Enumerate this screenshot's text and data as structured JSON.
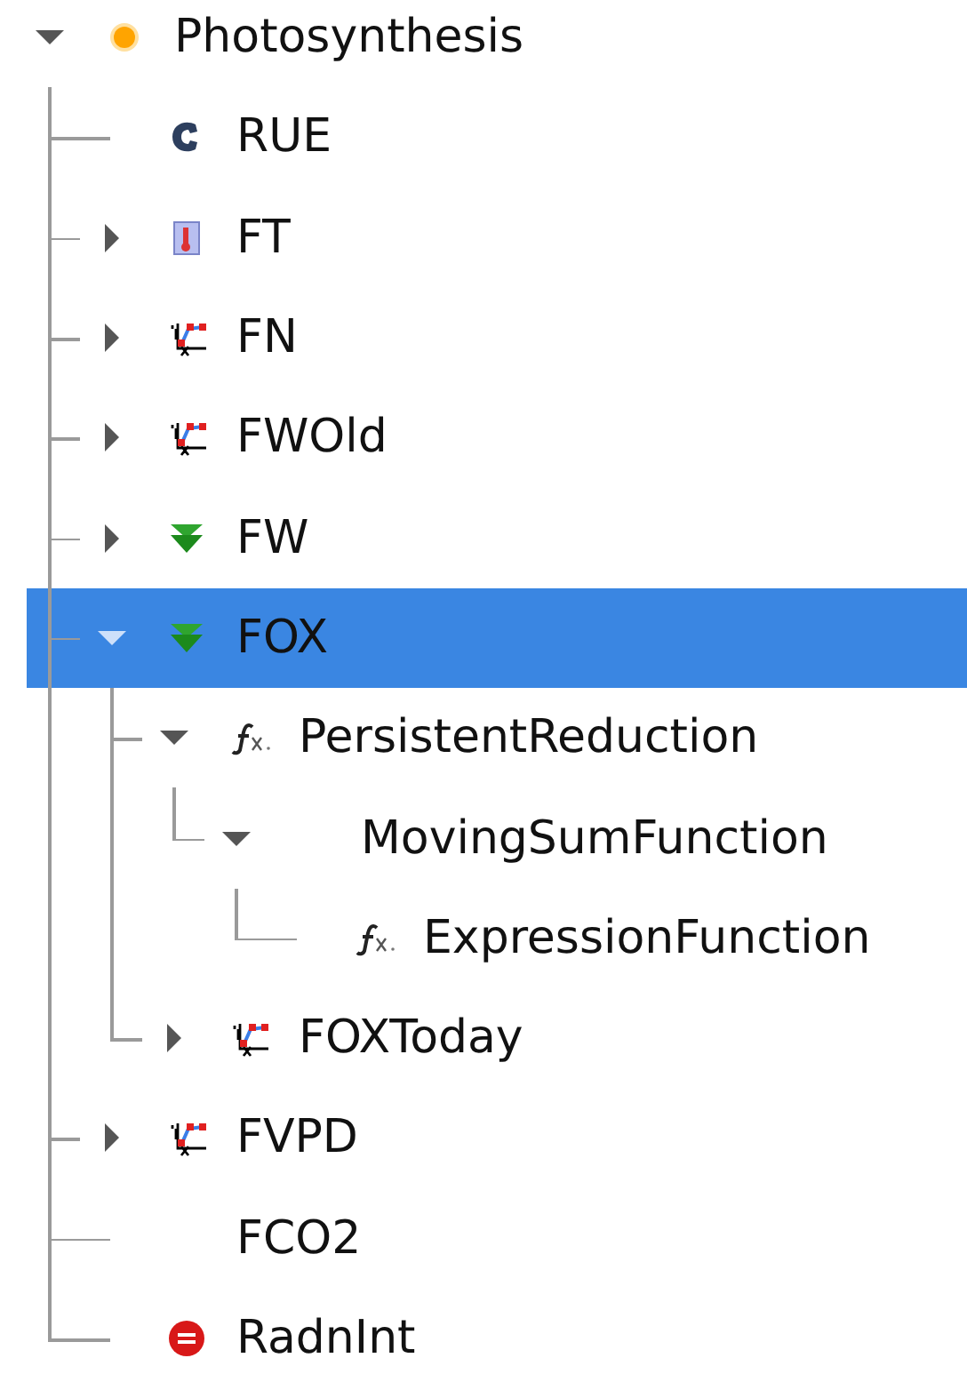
{
  "tree": [
    {
      "label": "Photosynthesis",
      "kind": "dot",
      "expanded": true,
      "selected": false,
      "children": [
        {
          "label": "RUE",
          "kind": "clamp",
          "selected": false
        },
        {
          "label": "FT",
          "kind": "thermometer",
          "expanded": false,
          "selected": false
        },
        {
          "label": "FN",
          "kind": "curve",
          "expanded": false,
          "selected": false
        },
        {
          "label": "FWOld",
          "kind": "curve",
          "expanded": false,
          "selected": false
        },
        {
          "label": "FW",
          "kind": "chevrons",
          "expanded": false,
          "selected": false
        },
        {
          "label": "FOX",
          "kind": "chevrons",
          "expanded": true,
          "selected": true,
          "children": [
            {
              "label": "PersistentReduction",
              "kind": "function",
              "expanded": true,
              "selected": false,
              "children": [
                {
                  "label": "MovingSumFunction",
                  "expanded": true,
                  "selected": false,
                  "children": [
                    {
                      "label": "ExpressionFunction",
                      "kind": "function",
                      "selected": false
                    }
                  ]
                }
              ]
            },
            {
              "label": "FOXToday",
              "kind": "curve",
              "expanded": false,
              "selected": false
            }
          ]
        },
        {
          "label": "FVPD",
          "kind": "curve",
          "expanded": false,
          "selected": false
        },
        {
          "label": "FCO2",
          "selected": false
        },
        {
          "label": "RadnInt",
          "kind": "stop",
          "selected": false
        }
      ]
    }
  ]
}
